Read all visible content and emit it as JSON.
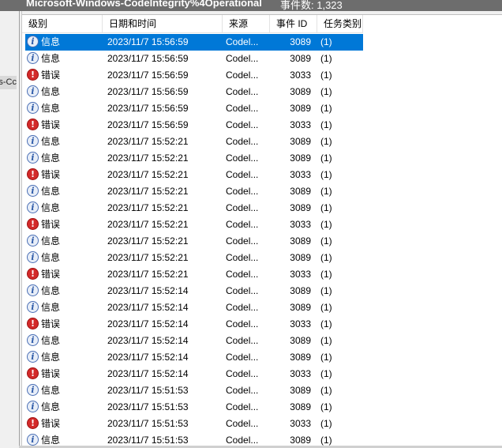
{
  "titlebar": {
    "log_name": "Microsoft-Windows-CodeIntegrity%4Operational",
    "event_count": "事件数: 1,323"
  },
  "left_fragment": "s-Cc",
  "columns": {
    "level": "级别",
    "datetime": "日期和时间",
    "source": "来源",
    "event_id": "事件 ID",
    "task_category": "任务类别"
  },
  "icons": {
    "info": "info-icon",
    "error": "error-icon"
  },
  "colors": {
    "selection": "#0078d7",
    "error_icon": "#d32a2a",
    "info_icon_border": "#4a6fb5"
  },
  "rows": [
    {
      "type": "info",
      "level": "信息",
      "datetime": "2023/11/7 15:56:59",
      "source": "Codel...",
      "event_id": "3089",
      "task": "(1)",
      "selected": true
    },
    {
      "type": "info",
      "level": "信息",
      "datetime": "2023/11/7 15:56:59",
      "source": "Codel...",
      "event_id": "3089",
      "task": "(1)"
    },
    {
      "type": "error",
      "level": "错误",
      "datetime": "2023/11/7 15:56:59",
      "source": "Codel...",
      "event_id": "3033",
      "task": "(1)"
    },
    {
      "type": "info",
      "level": "信息",
      "datetime": "2023/11/7 15:56:59",
      "source": "Codel...",
      "event_id": "3089",
      "task": "(1)"
    },
    {
      "type": "info",
      "level": "信息",
      "datetime": "2023/11/7 15:56:59",
      "source": "Codel...",
      "event_id": "3089",
      "task": "(1)"
    },
    {
      "type": "error",
      "level": "错误",
      "datetime": "2023/11/7 15:56:59",
      "source": "Codel...",
      "event_id": "3033",
      "task": "(1)"
    },
    {
      "type": "info",
      "level": "信息",
      "datetime": "2023/11/7 15:52:21",
      "source": "Codel...",
      "event_id": "3089",
      "task": "(1)"
    },
    {
      "type": "info",
      "level": "信息",
      "datetime": "2023/11/7 15:52:21",
      "source": "Codel...",
      "event_id": "3089",
      "task": "(1)"
    },
    {
      "type": "error",
      "level": "错误",
      "datetime": "2023/11/7 15:52:21",
      "source": "Codel...",
      "event_id": "3033",
      "task": "(1)"
    },
    {
      "type": "info",
      "level": "信息",
      "datetime": "2023/11/7 15:52:21",
      "source": "Codel...",
      "event_id": "3089",
      "task": "(1)"
    },
    {
      "type": "info",
      "level": "信息",
      "datetime": "2023/11/7 15:52:21",
      "source": "Codel...",
      "event_id": "3089",
      "task": "(1)"
    },
    {
      "type": "error",
      "level": "错误",
      "datetime": "2023/11/7 15:52:21",
      "source": "Codel...",
      "event_id": "3033",
      "task": "(1)"
    },
    {
      "type": "info",
      "level": "信息",
      "datetime": "2023/11/7 15:52:21",
      "source": "Codel...",
      "event_id": "3089",
      "task": "(1)"
    },
    {
      "type": "info",
      "level": "信息",
      "datetime": "2023/11/7 15:52:21",
      "source": "Codel...",
      "event_id": "3089",
      "task": "(1)"
    },
    {
      "type": "error",
      "level": "错误",
      "datetime": "2023/11/7 15:52:21",
      "source": "Codel...",
      "event_id": "3033",
      "task": "(1)"
    },
    {
      "type": "info",
      "level": "信息",
      "datetime": "2023/11/7 15:52:14",
      "source": "Codel...",
      "event_id": "3089",
      "task": "(1)"
    },
    {
      "type": "info",
      "level": "信息",
      "datetime": "2023/11/7 15:52:14",
      "source": "Codel...",
      "event_id": "3089",
      "task": "(1)"
    },
    {
      "type": "error",
      "level": "错误",
      "datetime": "2023/11/7 15:52:14",
      "source": "Codel...",
      "event_id": "3033",
      "task": "(1)"
    },
    {
      "type": "info",
      "level": "信息",
      "datetime": "2023/11/7 15:52:14",
      "source": "Codel...",
      "event_id": "3089",
      "task": "(1)"
    },
    {
      "type": "info",
      "level": "信息",
      "datetime": "2023/11/7 15:52:14",
      "source": "Codel...",
      "event_id": "3089",
      "task": "(1)"
    },
    {
      "type": "error",
      "level": "错误",
      "datetime": "2023/11/7 15:52:14",
      "source": "Codel...",
      "event_id": "3033",
      "task": "(1)"
    },
    {
      "type": "info",
      "level": "信息",
      "datetime": "2023/11/7 15:51:53",
      "source": "Codel...",
      "event_id": "3089",
      "task": "(1)"
    },
    {
      "type": "info",
      "level": "信息",
      "datetime": "2023/11/7 15:51:53",
      "source": "Codel...",
      "event_id": "3089",
      "task": "(1)"
    },
    {
      "type": "error",
      "level": "错误",
      "datetime": "2023/11/7 15:51:53",
      "source": "Codel...",
      "event_id": "3033",
      "task": "(1)"
    },
    {
      "type": "info",
      "level": "信息",
      "datetime": "2023/11/7 15:51:53",
      "source": "Codel...",
      "event_id": "3089",
      "task": "(1)"
    }
  ]
}
